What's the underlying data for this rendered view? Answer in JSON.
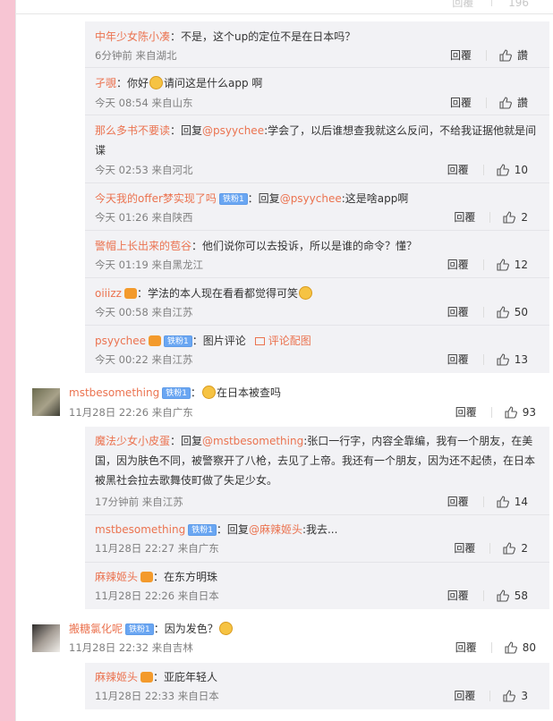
{
  "top_actions": {
    "reply": "回覆",
    "like": "196"
  },
  "labels": {
    "reply": "回覆",
    "badge": "铁粉1",
    "reply_prefix": "回复",
    "pic_comment": "图片评论",
    "view_pic": "评论配图"
  },
  "thread1_subs": [
    {
      "name": "中年少女陈小凑",
      "text": "：不是，这个up的定位不是在日本吗？",
      "time": "6分钟前 来自湖北",
      "likes": "讚"
    },
    {
      "name": "孑覗",
      "text_before": "：你好",
      "text_after": "请问这是什么app 啊",
      "time": "今天 08:54 来自山东",
      "likes": "讚"
    },
    {
      "name": "那么多书不要读",
      "text": "：回复",
      "mention": "@psyychee",
      "text2": ":学会了，以后谁想查我就这么反问，不给我证据他就是间谍",
      "time": "今天 02:53 来自河北",
      "likes": "10"
    },
    {
      "name": "今天我的offer梦实现了吗",
      "text": "：回复",
      "mention": "@psyychee",
      "text2": ":这是啥app啊",
      "time": "今天 01:26 来自陕西",
      "likes": "2"
    },
    {
      "name": "警帽上长出来的苞谷",
      "text": "：他们说你可以去投诉，所以是谁的命令？懂？",
      "time": "今天 01:19 来自黑龙江",
      "likes": "12"
    },
    {
      "name": "oiiizz",
      "text": "：学法的本人现在看看都觉得可笑",
      "time": "今天 00:58 来自江苏",
      "likes": "50"
    },
    {
      "name": "psyychee",
      "text": "：图片评论",
      "time": "今天 00:22 来自江苏",
      "likes": "13"
    }
  ],
  "comment2": {
    "name": "mstbesomething",
    "text": "在日本被查吗",
    "time": "11月28日 22:26 来自广东",
    "likes": "93"
  },
  "thread2_subs": [
    {
      "name": "魔法少女小皮蛋",
      "text": "：回复",
      "mention": "@mstbesomething",
      "text2": ":张口一行字，内容全靠编，我有一个朋友，在美国，因为肤色不同，被警察开了八枪，去见了上帝。我还有一个朋友，因为还不起债，在日本被黑社会拉去歌舞伎町做了失足少女。",
      "time": "17分钟前 来自江苏",
      "likes": "14"
    },
    {
      "name": "mstbesomething",
      "text": "：回复",
      "mention": "@麻辣姬头",
      "text2": ":我去...",
      "time": "11月28日 22:27 来自广东",
      "likes": "2"
    },
    {
      "name": "麻辣姬头",
      "text": "：在东方明珠",
      "time": "11月28日 22:26 来自日本",
      "likes": "58"
    }
  ],
  "comment3": {
    "name": "搬糖氯化呢",
    "text": "：因为发色？",
    "time": "11月28日 22:32 来自吉林",
    "likes": "80"
  },
  "thread3_subs": [
    {
      "name": "麻辣姬头",
      "text": "：亚庇年轻人",
      "time": "11月28日 22:33 来自日本",
      "likes": "3"
    }
  ]
}
